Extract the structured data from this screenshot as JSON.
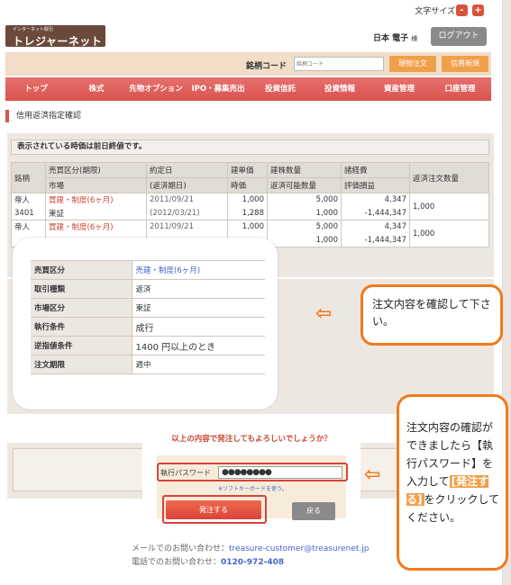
{
  "header": {
    "font_size_label": "文字サイズ",
    "font_minus": "-",
    "font_plus": "+",
    "logo_sub": "インターネット取引",
    "logo_main": "トレジャーネット",
    "user_name": "日本 電子",
    "user_suffix": "様",
    "logout": "ログアウト"
  },
  "codebar": {
    "label": "銘柄コード",
    "placeholder": "銘柄コード",
    "spot_order": "現物注文",
    "margin_new": "信用新規"
  },
  "nav": [
    "トップ",
    "株式",
    "先物オプション",
    "IPO・募集売出",
    "投資信託",
    "投資情報",
    "資産管理",
    "口座管理"
  ],
  "page_title": "信用返済指定確認",
  "notice": "表示されている時価は前日終値です。",
  "positions": {
    "headers": {
      "col1": "銘柄",
      "col2a": "売買区分(期限)",
      "col2b": "市場",
      "col3a": "約定日",
      "col3b": "(返済期日)",
      "col4a": "建単価",
      "col4b": "時価",
      "col5a": "建株数量",
      "col5b": "返済可能数量",
      "col6a": "諸経費",
      "col6b": "評価損益",
      "col7": "返済注文数量"
    },
    "rows": [
      {
        "name": "帝人",
        "code": "3401",
        "type": "買建・制度(6ヶ月)",
        "market": "東証",
        "date": "2011/09/21",
        "due": "(2012/03/21)",
        "price": "1,000",
        "market_price": "1,288",
        "qty": "5,000",
        "avail": "1,000",
        "cost": "4,347",
        "pnl": "-1,444,347",
        "order_qty": "1,000"
      },
      {
        "name": "帝人",
        "code": "",
        "type": "買建・制度(6ヶ月)",
        "market": "",
        "date": "2011/09/21",
        "due": "",
        "price": "1,000",
        "market_price": "",
        "qty": "5,000",
        "avail": "1,000",
        "cost": "4,347",
        "pnl": "-1,444,347",
        "order_qty": "1,000"
      }
    ]
  },
  "detail": [
    {
      "key": "売買区分",
      "value": "売建・制度(6ヶ月)",
      "blue": true
    },
    {
      "key": "取引種類",
      "value": "返済",
      "blue": false
    },
    {
      "key": "市場区分",
      "value": "東証",
      "blue": false
    },
    {
      "key": "執行条件",
      "value": "成行",
      "blue": false
    },
    {
      "key": "逆指値条件",
      "value": "1400 円以上のとき",
      "blue": false
    },
    {
      "key": "注文期限",
      "value": "週中",
      "blue": false
    }
  ],
  "confirm": {
    "question": "以上の内容で発注してもよろしいでしょうか？",
    "password_label": "執行パスワード",
    "password_value": "●●●●●●●●",
    "soft_keyboard": "※ソフトキーボードを使う。",
    "order_button": "発注する",
    "back_button": "戻る"
  },
  "footer": {
    "mail_label": "メールでのお問い合わせ：",
    "mail": "treasure-customer@treasurenet.jp",
    "tel_label": "電話でのお問い合わせ：",
    "tel": "0120-972-408"
  },
  "callouts": {
    "first": "注文内容を確認して下さい。",
    "second_a": "注文内容の確認ができましたら【執行パスワード】を入力して",
    "second_hl": "[発注する]",
    "second_b": "をクリックしてください。"
  },
  "colors": {
    "nav": "#d9534f",
    "accent_orange": "#f07a1c",
    "buy_red": "#cc4433",
    "link_blue": "#4466cc"
  }
}
